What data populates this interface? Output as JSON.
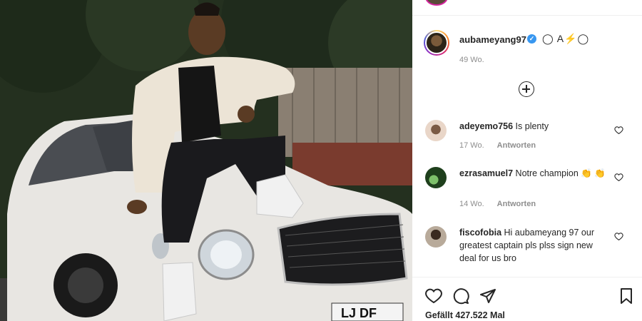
{
  "post": {
    "author": {
      "username": "aubameyang97",
      "verified_icon": "verified-badge-icon",
      "bio_text": "◯ A⚡◯",
      "time": "49 Wo."
    },
    "load_more_icon": "plus-circle-icon",
    "comments": [
      {
        "username": "adeyemo756",
        "text": "Is plenty",
        "time": "17 Wo.",
        "reply": "Antworten",
        "avatar_color": "#e9d6c8"
      },
      {
        "username": "ezrasamuel7",
        "text": "Notre champion 👏 👏",
        "time": "14 Wo.",
        "reply": "Antworten",
        "avatar_color": "#2f5e2a"
      },
      {
        "username": "fiscofobia",
        "text": "Hi aubameyang 97 our greatest captain pls plss sign new deal for us bro",
        "avatar_color": "#7a6a5a"
      }
    ],
    "likes_text": "Gefällt 427.522 Mal",
    "photo_plate_text": "LJ DF",
    "colors": {
      "verified": "#3897f0",
      "muted": "#8e8e8e",
      "text": "#262626"
    }
  }
}
